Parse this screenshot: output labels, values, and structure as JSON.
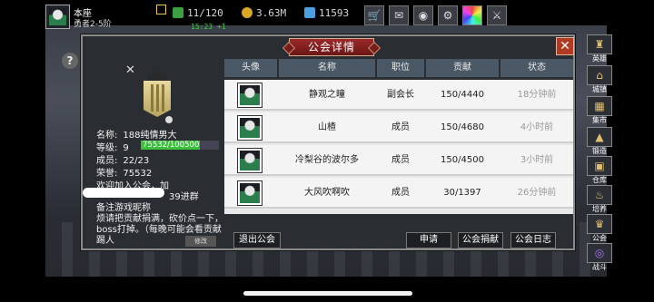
{
  "player": {
    "name": "本座",
    "rank": "勇者2-5阶"
  },
  "resources": {
    "stamina": "11/120",
    "stamina_timer": "15:23 +1",
    "gold": "3.63M",
    "gems": "11593"
  },
  "top_icons": [
    "shop-cart-icon",
    "mail-icon",
    "gamepad-icon",
    "settings-gear-icon",
    "color-wheel-icon",
    "sword-icon"
  ],
  "side_menu": [
    {
      "label": "英雄",
      "icon": "hero-icon"
    },
    {
      "label": "城镇",
      "icon": "town-icon"
    },
    {
      "label": "集市",
      "icon": "market-icon"
    },
    {
      "label": "锻造",
      "icon": "forge-icon"
    },
    {
      "label": "仓库",
      "icon": "warehouse-icon"
    },
    {
      "label": "培养",
      "icon": "train-icon"
    },
    {
      "label": "公会",
      "icon": "guild-icon"
    },
    {
      "label": "战斗",
      "icon": "battle-icon"
    }
  ],
  "dialog": {
    "title": "公会详情",
    "guild": {
      "name_label": "名称:",
      "name": "188纯情男大",
      "level_label": "等级:",
      "level": "9",
      "exp_text": "75532/100500",
      "exp_fraction": 0.7515,
      "members_label": "成员:",
      "members": "22/23",
      "honor_label": "荣誉:",
      "honor": "75532"
    },
    "notice": [
      "欢迎加入公会，加",
      "39进群",
      "备注游戏昵称",
      "烦请把贡献捐满，砍价点一下，boss打掉。（每晚可能会看贡献踢人"
    ],
    "edit_label": "修改",
    "table": {
      "headers": [
        "头像",
        "名称",
        "职位",
        "贡献",
        "状态"
      ],
      "rows": [
        {
          "name": "静观之瞳",
          "position": "副会长",
          "contribution": "150/4440",
          "status": "18分钟前"
        },
        {
          "name": "山楂",
          "position": "成员",
          "contribution": "150/4680",
          "status": "4小时前"
        },
        {
          "name": "冷梨谷的波尔多",
          "position": "成员",
          "contribution": "150/4500",
          "status": "3小时前"
        },
        {
          "name": "大风吹啊吹",
          "position": "成员",
          "contribution": "30/1397",
          "status": "26分钟前"
        }
      ]
    },
    "buttons": {
      "leave": "退出公会",
      "apply": "申请",
      "donate": "公会捐献",
      "log": "公会日志"
    }
  }
}
